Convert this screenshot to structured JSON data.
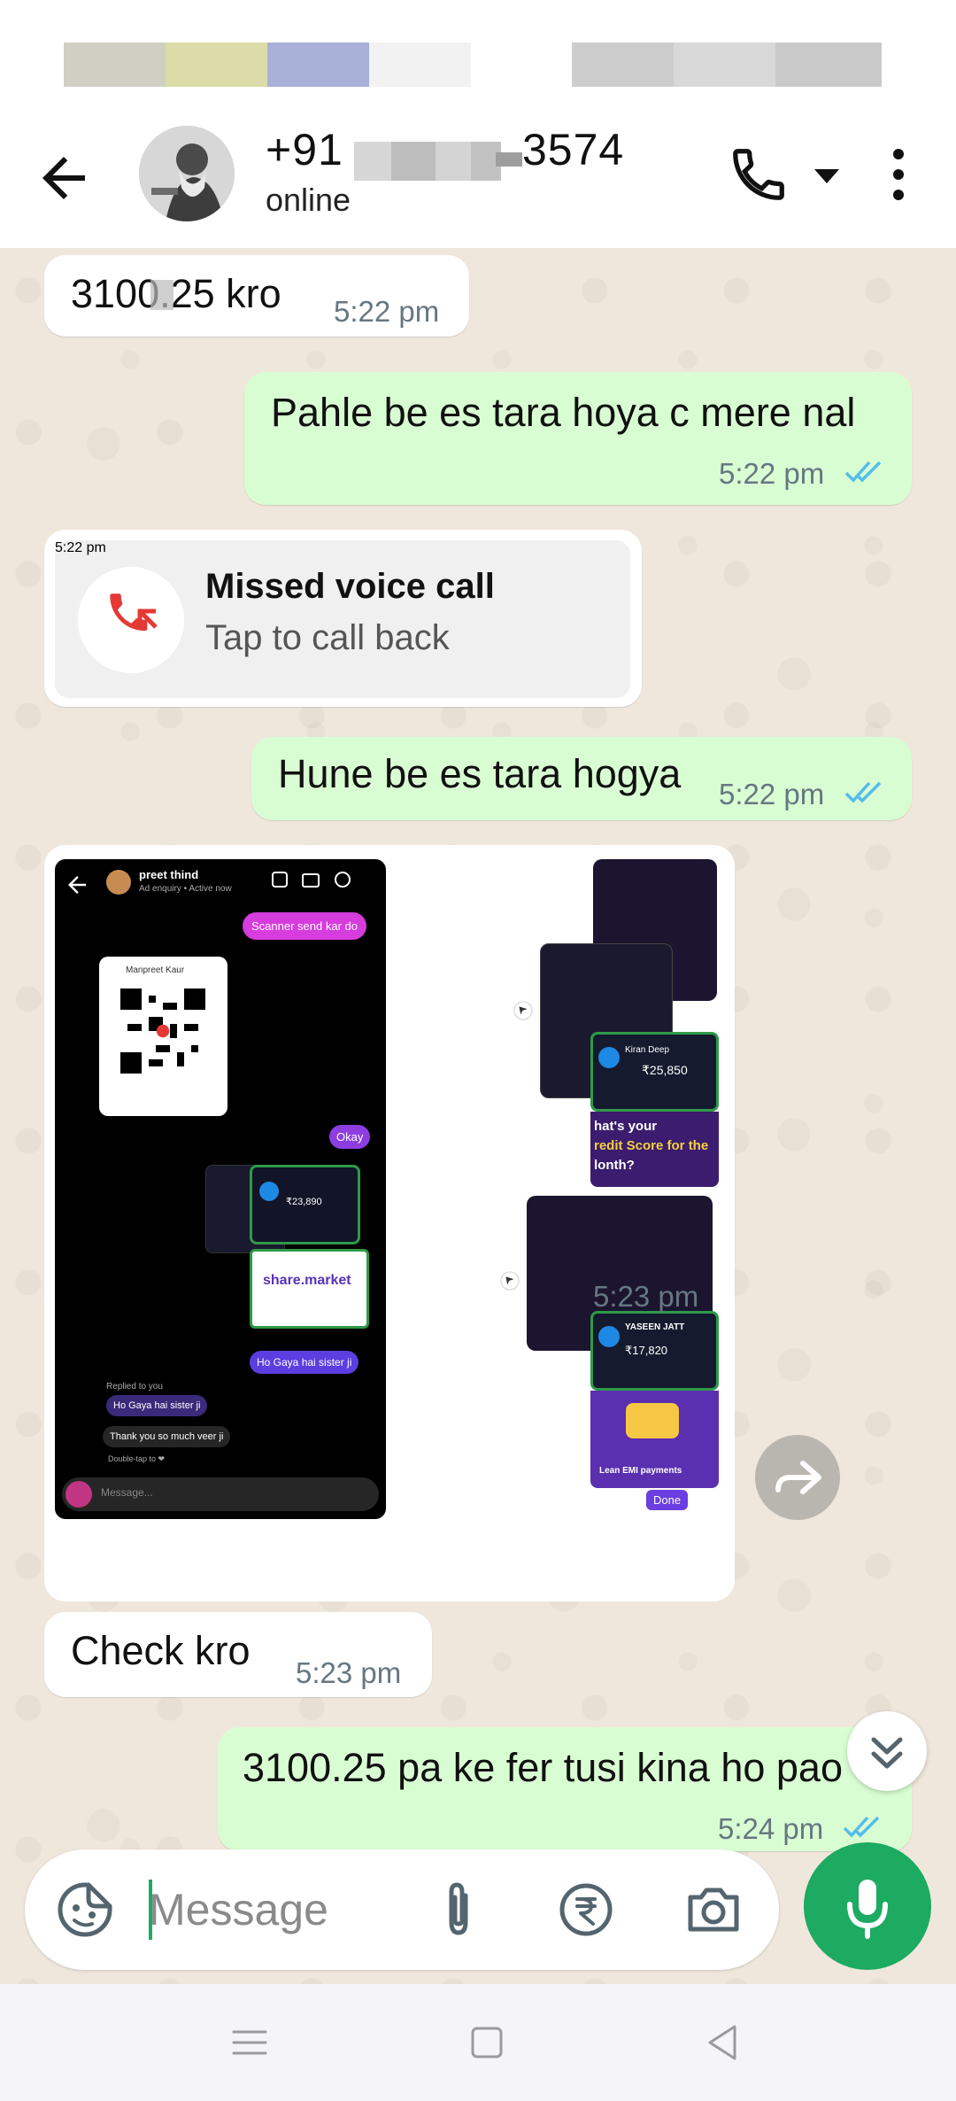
{
  "header": {
    "contact_prefix": "+91",
    "contact_suffix": "3574",
    "status": "online"
  },
  "messages": [
    {
      "direction": "in",
      "text": "3100.25 kro",
      "time": "5:22 pm"
    },
    {
      "direction": "out",
      "text": "Pahle be es tara hoya c mere nal",
      "time": "5:22 pm",
      "read": true
    },
    {
      "direction": "in",
      "type": "missed_call",
      "title": "Missed voice call",
      "subtitle": "Tap to call back",
      "time": "5:22 pm"
    },
    {
      "direction": "out",
      "text": "Hune be es tara hogya",
      "time": "5:22 pm",
      "read": true
    },
    {
      "direction": "in",
      "type": "images",
      "time": "5:23 pm"
    },
    {
      "direction": "in",
      "text": "Check kro",
      "time": "5:23 pm"
    },
    {
      "direction": "out",
      "text": "3100.25 pa ke fer tusi kina ho pao",
      "time": "5:24 pm",
      "read": true
    }
  ],
  "screenshot_text": {
    "ig_name": "preet thind",
    "ig_status": "Ad enquiry • Active now",
    "scanner_msg": "Scanner send kar do",
    "qr_name": "Manpreet Kaur",
    "okay": "Okay",
    "ho_gaya": "Ho Gaya hai sister ji",
    "replied": "Replied to you",
    "thanks": "Thank you so much veer ji",
    "double_tap": "Double-tap to ❤",
    "ig_message_placeholder": "Message...",
    "kiran": "Kiran Deep",
    "amount1": "₹25,850",
    "credit1": "hat's your",
    "credit2": "redit Score for the",
    "credit3": "lonth?",
    "yaseen": "YASEEN JATT",
    "amount2": "₹17,820",
    "amount3": "₹23,890",
    "share_market": "share.market",
    "done": "Done",
    "lean": "Lean EMI payments"
  },
  "compose": {
    "placeholder": "Message"
  },
  "colors": {
    "outgoing_bubble": "#d9fdd3",
    "incoming_bubble": "#ffffff",
    "chat_bg": "#efe7dc",
    "accent_green": "#1daa61",
    "read_ticks": "#53bdeb",
    "missed_call_red": "#e53935"
  },
  "icons": {
    "back": "arrow-left-icon",
    "call": "phone-icon",
    "menu": "more-vert-icon",
    "emoji": "sticker-icon",
    "attach": "paperclip-icon",
    "payment": "rupee-icon",
    "camera": "camera-icon",
    "mic": "mic-icon",
    "forward": "forward-icon",
    "scroll": "double-chevron-down-icon"
  }
}
